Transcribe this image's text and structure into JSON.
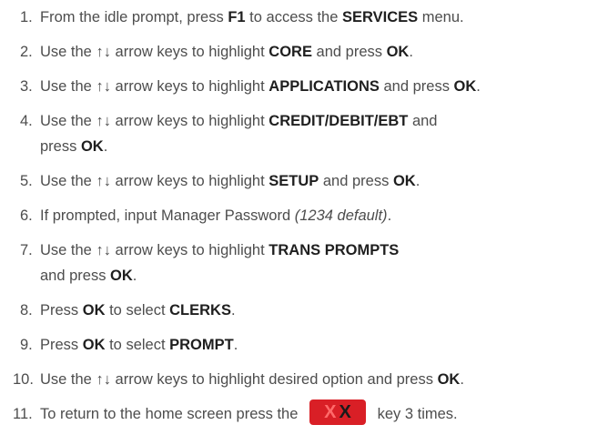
{
  "steps": [
    {
      "num": "1.",
      "parts": [
        {
          "t": "From the idle prompt, press "
        },
        {
          "t": "F1",
          "hl": true
        },
        {
          "t": " to access the "
        },
        {
          "t": "SERVICES",
          "hl": true
        },
        {
          "t": " menu."
        }
      ]
    },
    {
      "num": "2.",
      "parts": [
        {
          "t": "Use the ↑↓ arrow keys to highlight "
        },
        {
          "t": "CORE",
          "hl": true
        },
        {
          "t": " and press "
        },
        {
          "t": "OK",
          "hl": true
        },
        {
          "t": "."
        }
      ]
    },
    {
      "num": "3.",
      "parts": [
        {
          "t": "Use the ↑↓ arrow keys to highlight "
        },
        {
          "t": "APPLICATIONS",
          "hl": true
        },
        {
          "t": " and press "
        },
        {
          "t": "OK",
          "hl": true
        },
        {
          "t": "."
        }
      ]
    },
    {
      "num": "4.",
      "parts": [
        {
          "t": "Use the ↑↓ arrow keys to highlight "
        },
        {
          "t": "CREDIT/DEBIT/EBT",
          "hl": true
        },
        {
          "t": " and"
        },
        {
          "br": true
        },
        {
          "t": "press "
        },
        {
          "t": "OK",
          "hl": true
        },
        {
          "t": "."
        }
      ]
    },
    {
      "num": "5.",
      "parts": [
        {
          "t": "Use the ↑↓ arrow keys to highlight "
        },
        {
          "t": "SETUP",
          "hl": true
        },
        {
          "t": " and press "
        },
        {
          "t": "OK",
          "hl": true
        },
        {
          "t": "."
        }
      ]
    },
    {
      "num": "6.",
      "parts": [
        {
          "t": "If prompted, input Manager Password "
        },
        {
          "t": "(1234 default)",
          "it": true
        },
        {
          "t": "."
        }
      ]
    },
    {
      "num": "7.",
      "parts": [
        {
          "t": "Use the ↑↓ arrow keys to highlight "
        },
        {
          "t": "TRANS PROMPTS",
          "hl": true
        },
        {
          "br": true
        },
        {
          "t": "and press "
        },
        {
          "t": "OK",
          "hl": true
        },
        {
          "t": "."
        }
      ]
    },
    {
      "num": "8.",
      "parts": [
        {
          "t": "Press "
        },
        {
          "t": "OK",
          "hl": true
        },
        {
          "t": " to select "
        },
        {
          "t": "CLERKS",
          "hl": true
        },
        {
          "t": "."
        }
      ]
    },
    {
      "num": "9.",
      "parts": [
        {
          "t": "Press "
        },
        {
          "t": "OK",
          "hl": true
        },
        {
          "t": " to select "
        },
        {
          "t": "PROMPT",
          "hl": true
        },
        {
          "t": "."
        }
      ]
    },
    {
      "num": "10.",
      "parts": [
        {
          "t": "Use the ↑↓ arrow keys to highlight desired option and press "
        },
        {
          "t": "OK",
          "hl": true
        },
        {
          "t": "."
        }
      ]
    },
    {
      "num": "11.",
      "parts": [
        {
          "t": "To return to the home screen press the "
        },
        {
          "key": true
        },
        {
          "t": " key 3 times."
        }
      ]
    }
  ],
  "cancel_key": {
    "left_x": "X",
    "right_x": "X",
    "color": "#d91f26"
  }
}
